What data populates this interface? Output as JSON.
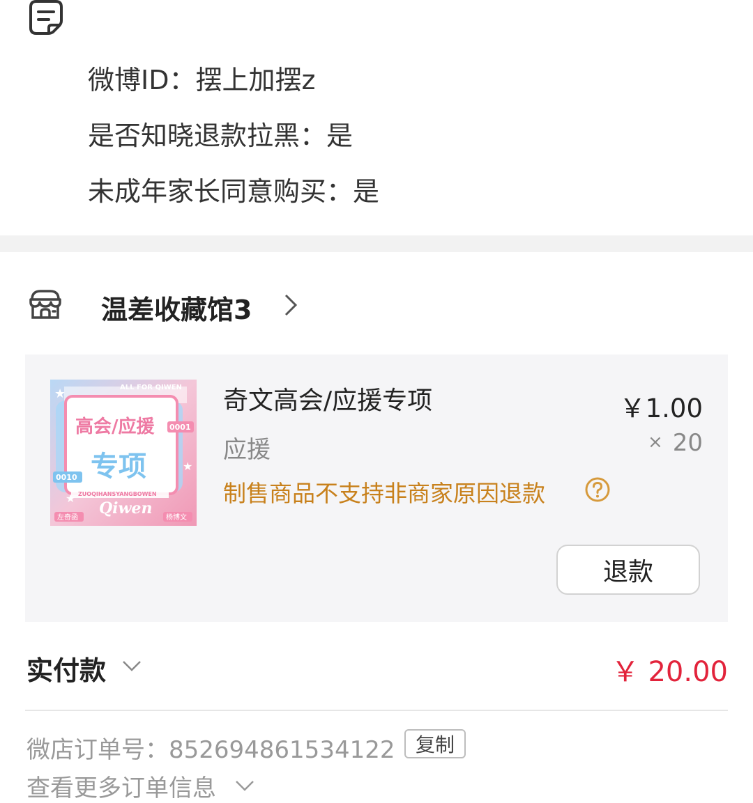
{
  "notes": {
    "icon": "note-icon",
    "lines": [
      "微博ID：摆上加摆z",
      "是否知晓退款拉黑：是",
      "未成年家长同意购买：是"
    ]
  },
  "shop": {
    "icon": "shop-icon",
    "name": "温差收藏馆3"
  },
  "product": {
    "title": "奇文高会/应援专项",
    "price": "￥1.00",
    "sku": "应援",
    "qty_symbol": "×",
    "qty": "20",
    "warning": "制售商品不支持非商家原因退款",
    "refund_label": "退款",
    "thumbnail": {
      "top_text": "ALL FOR QIWEN",
      "line1": "高会/应援",
      "line2": "专项",
      "code_right": "0001",
      "code_left": "0010",
      "subtitle": "ZUOQIHANSYANGBOWEN",
      "script": "Qiwen",
      "badge_left": "左奇函",
      "badge_right": "杨博文"
    }
  },
  "payment": {
    "label": "实付款",
    "amount": "￥ 20.00"
  },
  "order": {
    "label": "微店订单号：852694861534122",
    "copy_label": "复制",
    "more_label": "查看更多订单信息"
  },
  "colors": {
    "accent_red": "#e2233b",
    "warning_orange": "#c8811c"
  }
}
